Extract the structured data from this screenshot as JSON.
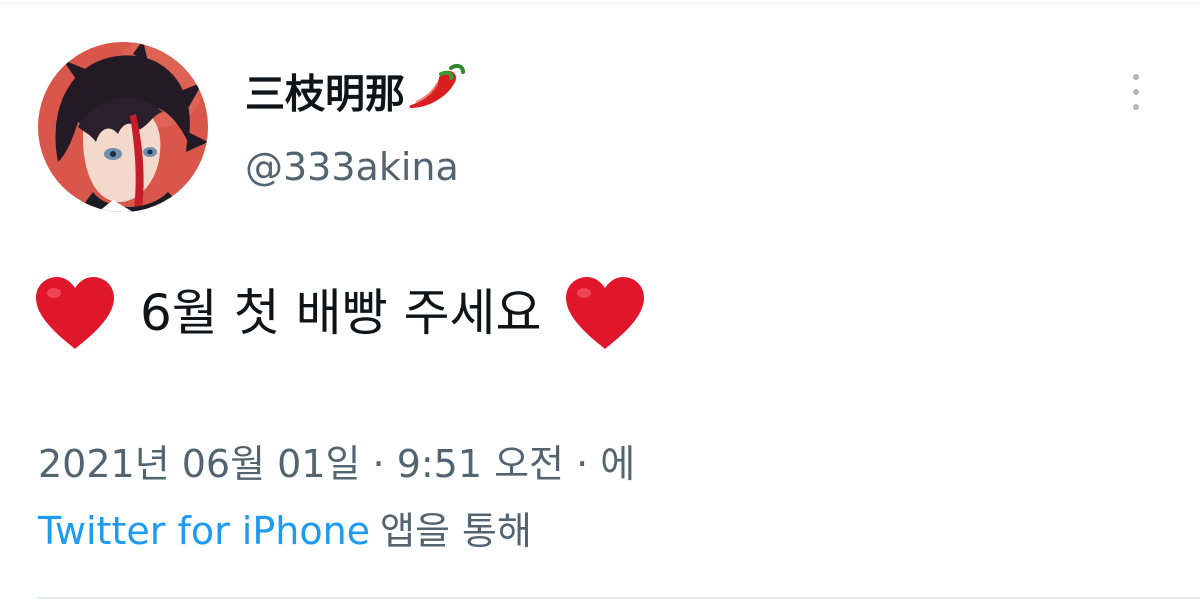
{
  "user": {
    "display_name": "三枝明那",
    "name_emoji_icon": "chili-pepper-icon",
    "handle": "@333akina",
    "avatar_icon": "avatar-illustration"
  },
  "menu": {
    "more_icon": "more-vertical-icon"
  },
  "tweet": {
    "text": "6월 첫 배빵 주세요",
    "leading_emoji_icon": "red-heart-icon",
    "trailing_emoji_icon": "red-heart-icon",
    "datetime": "2021년 06월 01일 · 9:51 오전 · 에",
    "source_app": "Twitter for iPhone",
    "source_suffix": "앱을 통해"
  },
  "colors": {
    "text_primary": "#0f1419",
    "text_secondary": "#536471",
    "link": "#1d9bf0",
    "heart": "#e0162b",
    "avatar_bg": "#d9574a"
  }
}
